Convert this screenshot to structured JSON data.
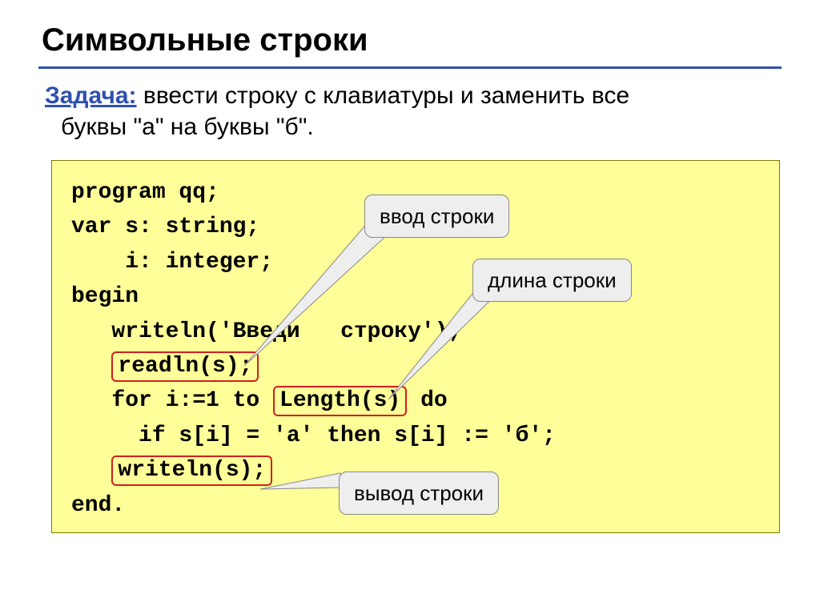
{
  "title": "Символьные строки",
  "task": {
    "label": "Задача:",
    "text_line1": " ввести строку с клавиатуры и заменить все",
    "text_line2": "буквы \"а\" на буквы \"б\"."
  },
  "code": {
    "l1": "program qq;",
    "l2": "var s: string;",
    "l3": "    i: integer;",
    "l4": "begin",
    "l5a": "   writeln('Введи",
    "l5b": " строку');",
    "l6_pre": "   ",
    "l6_hl": "readln(s);",
    "l7a": "   for i:=1 to ",
    "l7_hl": "Length(s)",
    "l7b": " do",
    "l8": "     if s[i] = 'а' then s[i] := 'б';",
    "l9_pre": "   ",
    "l9_hl": "writeln(s);",
    "l10": "end."
  },
  "callouts": {
    "input": "ввод строки",
    "length": "длина строки",
    "output": "вывод строки"
  }
}
